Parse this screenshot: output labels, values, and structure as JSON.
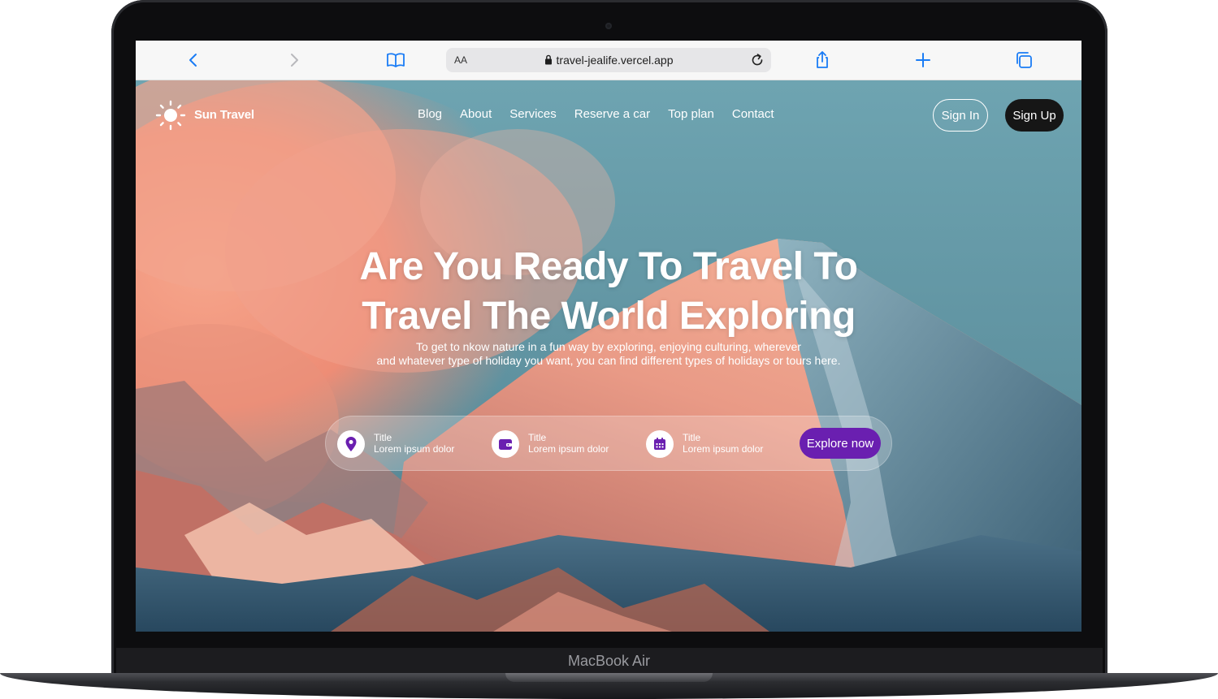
{
  "device": {
    "brand_label": "MacBook Air"
  },
  "browser": {
    "url": "travel-jealife.vercel.app",
    "text_size_label": "AA",
    "icons": [
      "back-icon",
      "forward-icon",
      "bookmarks-icon",
      "lock-icon",
      "reload-icon",
      "share-icon",
      "new-tab-icon",
      "tabs-icon"
    ]
  },
  "site": {
    "logo_text": "Sun Travel",
    "nav": [
      {
        "label": "Blog"
      },
      {
        "label": "About"
      },
      {
        "label": "Services"
      },
      {
        "label": "Reserve a car"
      },
      {
        "label": "Top plan"
      },
      {
        "label": "Contact"
      }
    ],
    "sign_in_label": "Sign In",
    "sign_up_label": "Sign Up"
  },
  "hero": {
    "headline_line1": "Are You Ready To Travel To",
    "headline_line2": "Travel The World Exploring",
    "subtext_line1": "To get to nkow nature in a fun way by exploring, enjoying culturing, wherever",
    "subtext_line2": "and whatever type of holiday you want, you can find different types of holidays or tours here.",
    "info_items": [
      {
        "title": "Title",
        "desc": "Lorem ipsum dolor",
        "icon": "location-pin-icon"
      },
      {
        "title": "Title",
        "desc": "Lorem ipsum dolor",
        "icon": "wallet-icon"
      },
      {
        "title": "Title",
        "desc": "Lorem ipsum dolor",
        "icon": "calendar-icon"
      }
    ],
    "cta_label": "Explore now"
  },
  "colors": {
    "accent": "#6a1fb0",
    "browser_blue": "#1a7cf5",
    "sign_up_bg": "#161616"
  }
}
